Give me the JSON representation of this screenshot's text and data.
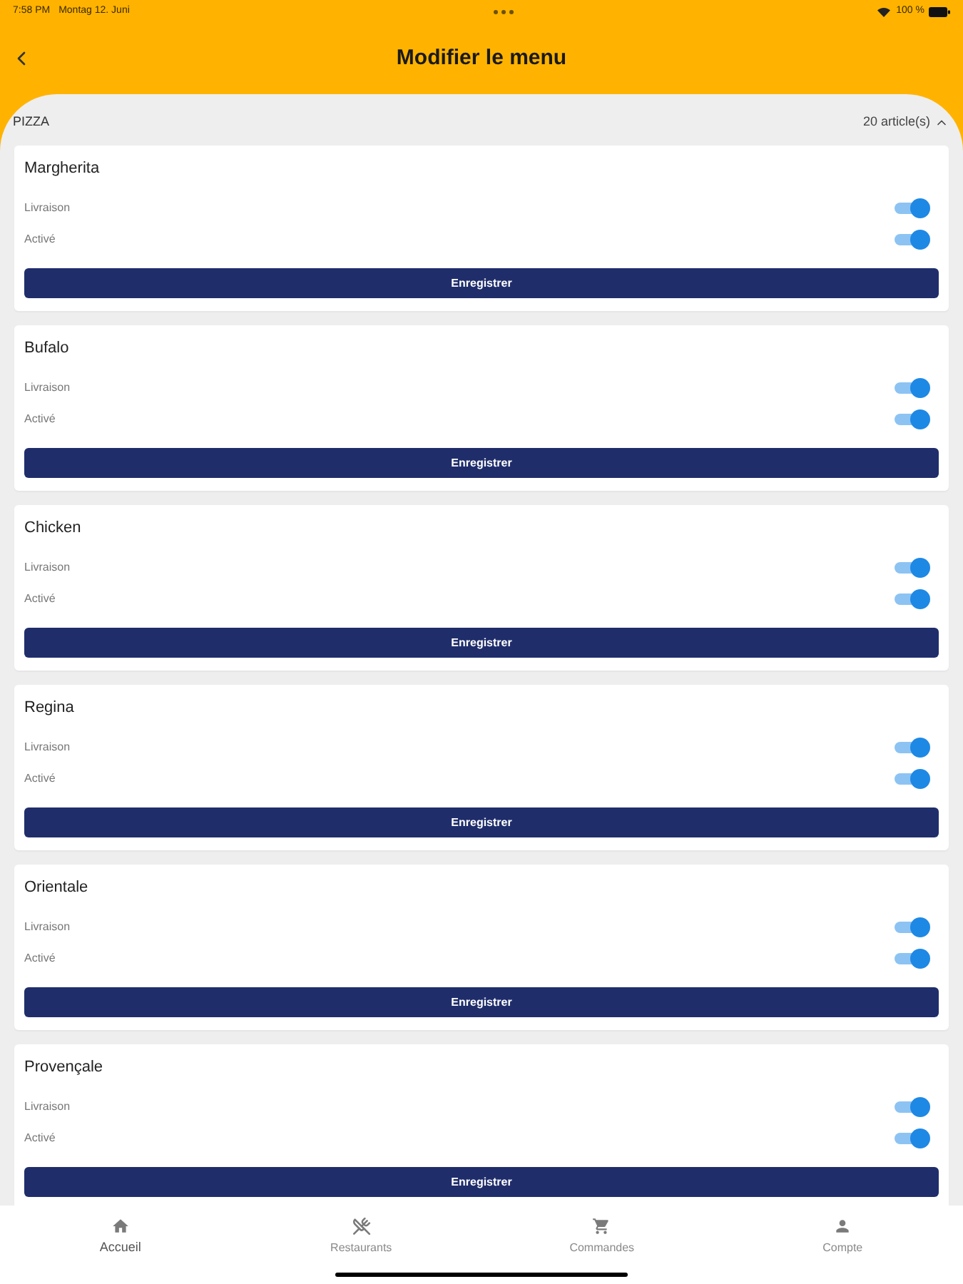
{
  "status_bar": {
    "time": "7:58 PM",
    "date": "Montag 12. Juni",
    "battery": "100 %"
  },
  "header": {
    "title": "Modifier le menu"
  },
  "section": {
    "title": "PIZZA",
    "count": "20 article(s)",
    "expanded": true
  },
  "items": [
    {
      "name": "Margherita",
      "toggles": [
        {
          "label": "Livraison",
          "on": true
        },
        {
          "label": "Activé",
          "on": true
        }
      ],
      "button": "Enregistrer"
    },
    {
      "name": "Bufalo",
      "toggles": [
        {
          "label": "Livraison",
          "on": true
        },
        {
          "label": "Activé",
          "on": true
        }
      ],
      "button": "Enregistrer"
    },
    {
      "name": "Chicken",
      "toggles": [
        {
          "label": "Livraison",
          "on": true
        },
        {
          "label": "Activé",
          "on": true
        }
      ],
      "button": "Enregistrer"
    },
    {
      "name": "Regina",
      "toggles": [
        {
          "label": "Livraison",
          "on": true
        },
        {
          "label": "Activé",
          "on": true
        }
      ],
      "button": "Enregistrer"
    },
    {
      "name": "Orientale",
      "toggles": [
        {
          "label": "Livraison",
          "on": true
        },
        {
          "label": "Activé",
          "on": true
        }
      ],
      "button": "Enregistrer"
    },
    {
      "name": "Provençale",
      "toggles": [
        {
          "label": "Livraison",
          "on": true
        },
        {
          "label": "Activé",
          "on": true
        }
      ],
      "button": "Enregistrer"
    }
  ],
  "bottom_nav": [
    {
      "label": "Accueil",
      "kind": "home",
      "selected": true
    },
    {
      "label": "Restaurants",
      "kind": "restaurants",
      "selected": false
    },
    {
      "label": "Commandes",
      "kind": "orders",
      "selected": false
    },
    {
      "label": "Compte",
      "kind": "account",
      "selected": false
    }
  ]
}
